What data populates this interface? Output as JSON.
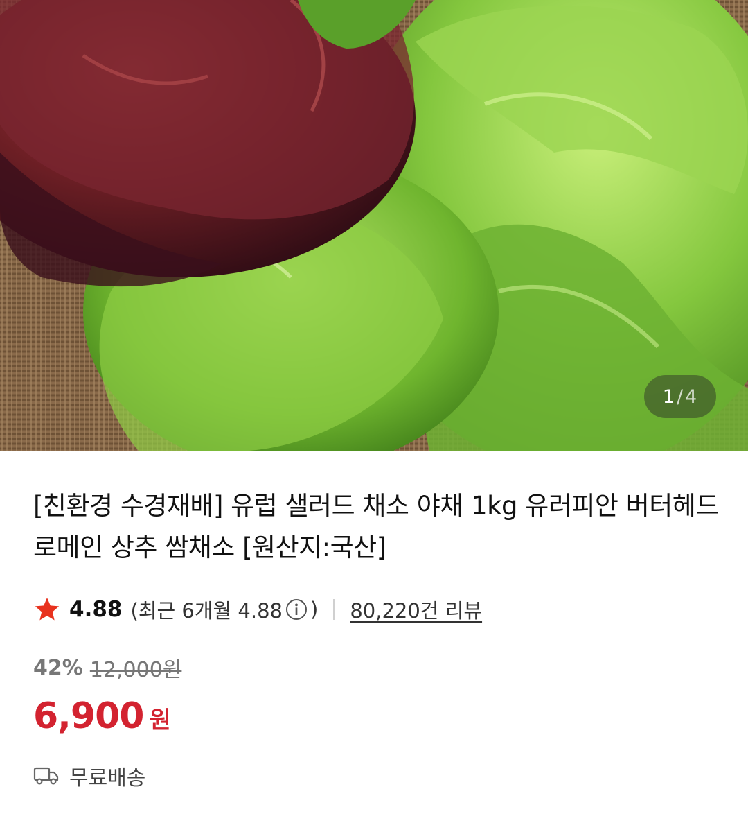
{
  "carousel": {
    "current": "1",
    "separator": "/",
    "total": "4",
    "image_desc_icon": "lettuce-photo"
  },
  "product": {
    "title": "[친환경 수경재배] 유럽 샐러드 채소 야채 1kg 유러피안 버터헤드 로메인 상추 쌈채소 [원산지:국산]"
  },
  "rating": {
    "score": "4.88",
    "recent_label": "(최근 6개월 4.88",
    "recent_close": ")",
    "review_count": "80,220건 리뷰",
    "star_color": "#e8321e"
  },
  "price": {
    "discount": "42%",
    "original": "12,000원",
    "sale": "6,900",
    "sale_unit": "원",
    "sale_color": "#d32330"
  },
  "shipping": {
    "label": "무료배송",
    "icon": "truck-icon"
  }
}
